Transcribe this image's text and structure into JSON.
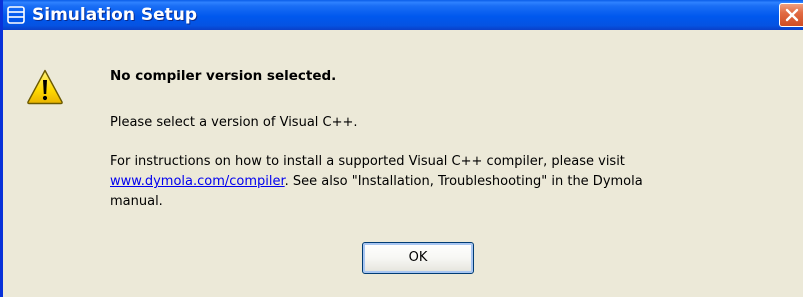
{
  "window": {
    "title": "Simulation Setup",
    "title_icon": "dymola-window-icon",
    "close_icon": "close-icon"
  },
  "dialog": {
    "icon": "warning-icon",
    "heading": "No compiler version selected.",
    "message1": "Please select a version of Visual C++.",
    "message2_line1": "For instructions on how to install a supported Visual C++ compiler, please visit",
    "message2_link": "www.dymola.com/compiler",
    "message2_line2_rest": ". See also \"Installation, Troubleshooting\" in the Dymola",
    "message2_line3": "manual.",
    "ok_label": "OK"
  },
  "colors": {
    "titlebar": "#0058ee",
    "window_bg": "#ece9d8",
    "close_button": "#e26b43",
    "warning_fill": "#ffd900",
    "link": "#0000ee"
  }
}
